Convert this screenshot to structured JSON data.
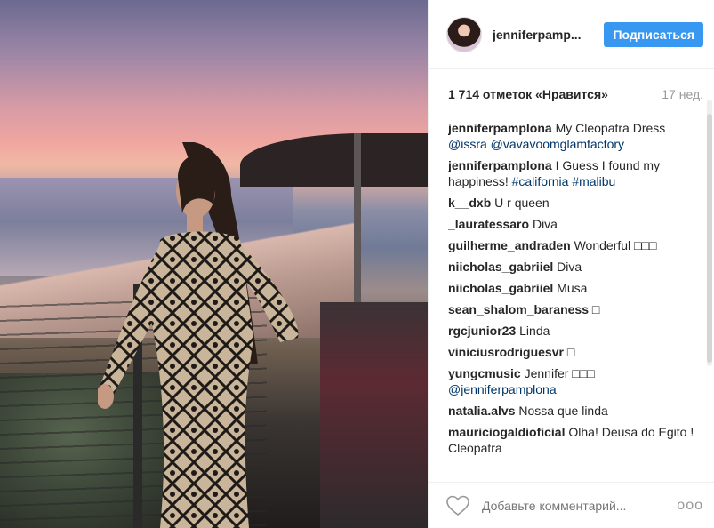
{
  "post": {
    "username": "jenniferpamp...",
    "follow_label": "Подписаться",
    "likes": "1 714 отметок «Нравится»",
    "time": "17 нед."
  },
  "comments": [
    {
      "user": "jenniferpamplona",
      "text": "My Cleopatra Dress",
      "tags": "@issra @vavavoomglamfactory"
    },
    {
      "user": "jenniferpamplona",
      "text": "I Guess I found my happiness!",
      "tags": "#california #malibu"
    },
    {
      "user": "k__dxb",
      "text": "U r queen",
      "tags": ""
    },
    {
      "user": "_lauratessaro",
      "text": "Diva",
      "tags": ""
    },
    {
      "user": "guilherme_andraden",
      "text": "Wonderful □□□",
      "tags": ""
    },
    {
      "user": "niicholas_gabriiel",
      "text": "Diva",
      "tags": ""
    },
    {
      "user": "niicholas_gabriiel",
      "text": "Musa",
      "tags": ""
    },
    {
      "user": "sean_shalom_baraness",
      "text": "□",
      "tags": ""
    },
    {
      "user": "rgcjunior23",
      "text": "Linda",
      "tags": ""
    },
    {
      "user": "viniciusrodriguesvr",
      "text": "□",
      "tags": ""
    },
    {
      "user": "yungcmusic",
      "text": "Jennifer □□□",
      "tags": "@jenniferpamplona"
    },
    {
      "user": "natalia.alvs",
      "text": "Nossa que linda",
      "tags": ""
    },
    {
      "user": "mauriciogaldioficial",
      "text": "Olha! Deusa do Egito ! Cleopatra",
      "tags": ""
    }
  ],
  "footer": {
    "placeholder": "Добавьте комментарий...",
    "more": "ooo"
  },
  "icons": {
    "like": "heart-icon",
    "more": "more-options-icon"
  },
  "colors": {
    "accent": "#3897f0",
    "tag": "#003569"
  }
}
